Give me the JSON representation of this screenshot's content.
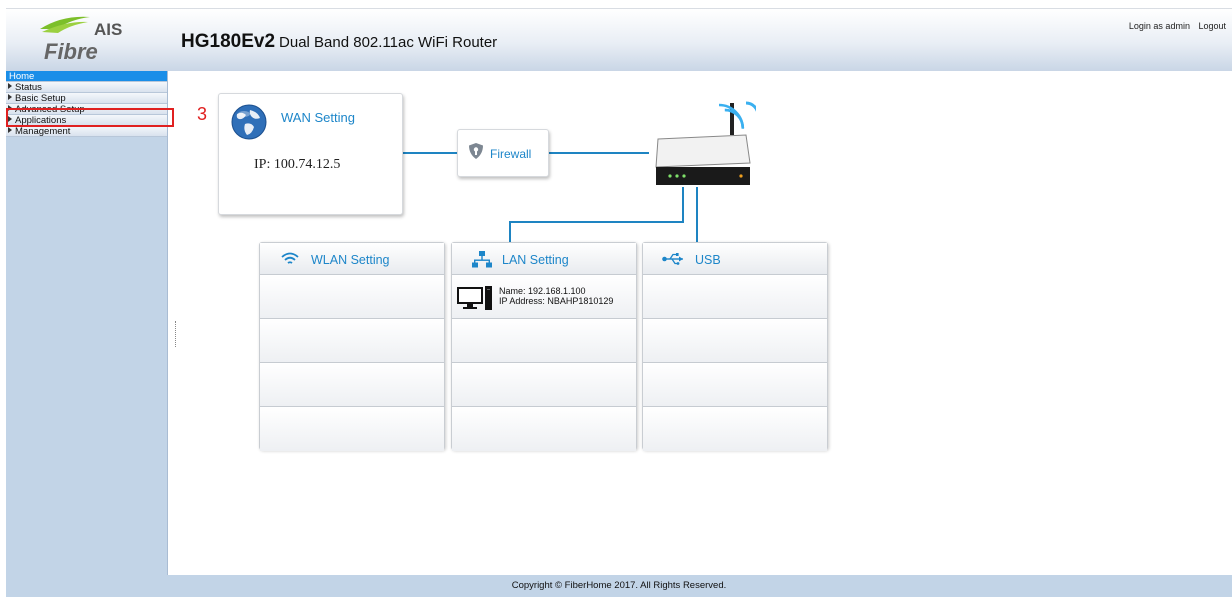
{
  "header": {
    "logo_text_top": "AIS",
    "logo_text_bottom": "Fibre",
    "model": "HG180Ev2",
    "subtitle": "Dual Band 802.11ac WiFi Router",
    "login_label": "Login as admin",
    "logout_label": "Logout"
  },
  "sidebar": {
    "items": [
      {
        "label": "Home"
      },
      {
        "label": "Status"
      },
      {
        "label": "Basic Setup"
      },
      {
        "label": "Advanced Setup"
      },
      {
        "label": "Applications"
      },
      {
        "label": "Management"
      }
    ]
  },
  "annotation": {
    "step_number": "3",
    "color": "#e02020"
  },
  "wan": {
    "title": "WAN Setting",
    "ip_text": "IP: 100.74.12.5"
  },
  "firewall": {
    "label": "Firewall"
  },
  "columns": {
    "wlan": {
      "title": "WLAN Setting"
    },
    "lan": {
      "title": "LAN Setting",
      "device": {
        "name_line": "Name: 192.168.1.100",
        "ip_line": "IP Address: NBAHP1810129"
      }
    },
    "usb": {
      "title": "USB"
    }
  },
  "footer": {
    "copyright": "Copyright © FiberHome 2017. All Rights Reserved."
  },
  "colors": {
    "accent": "#1d86c9",
    "active_menu": "#1a8ee8",
    "sidebar_bg": "#c2d4e7"
  }
}
